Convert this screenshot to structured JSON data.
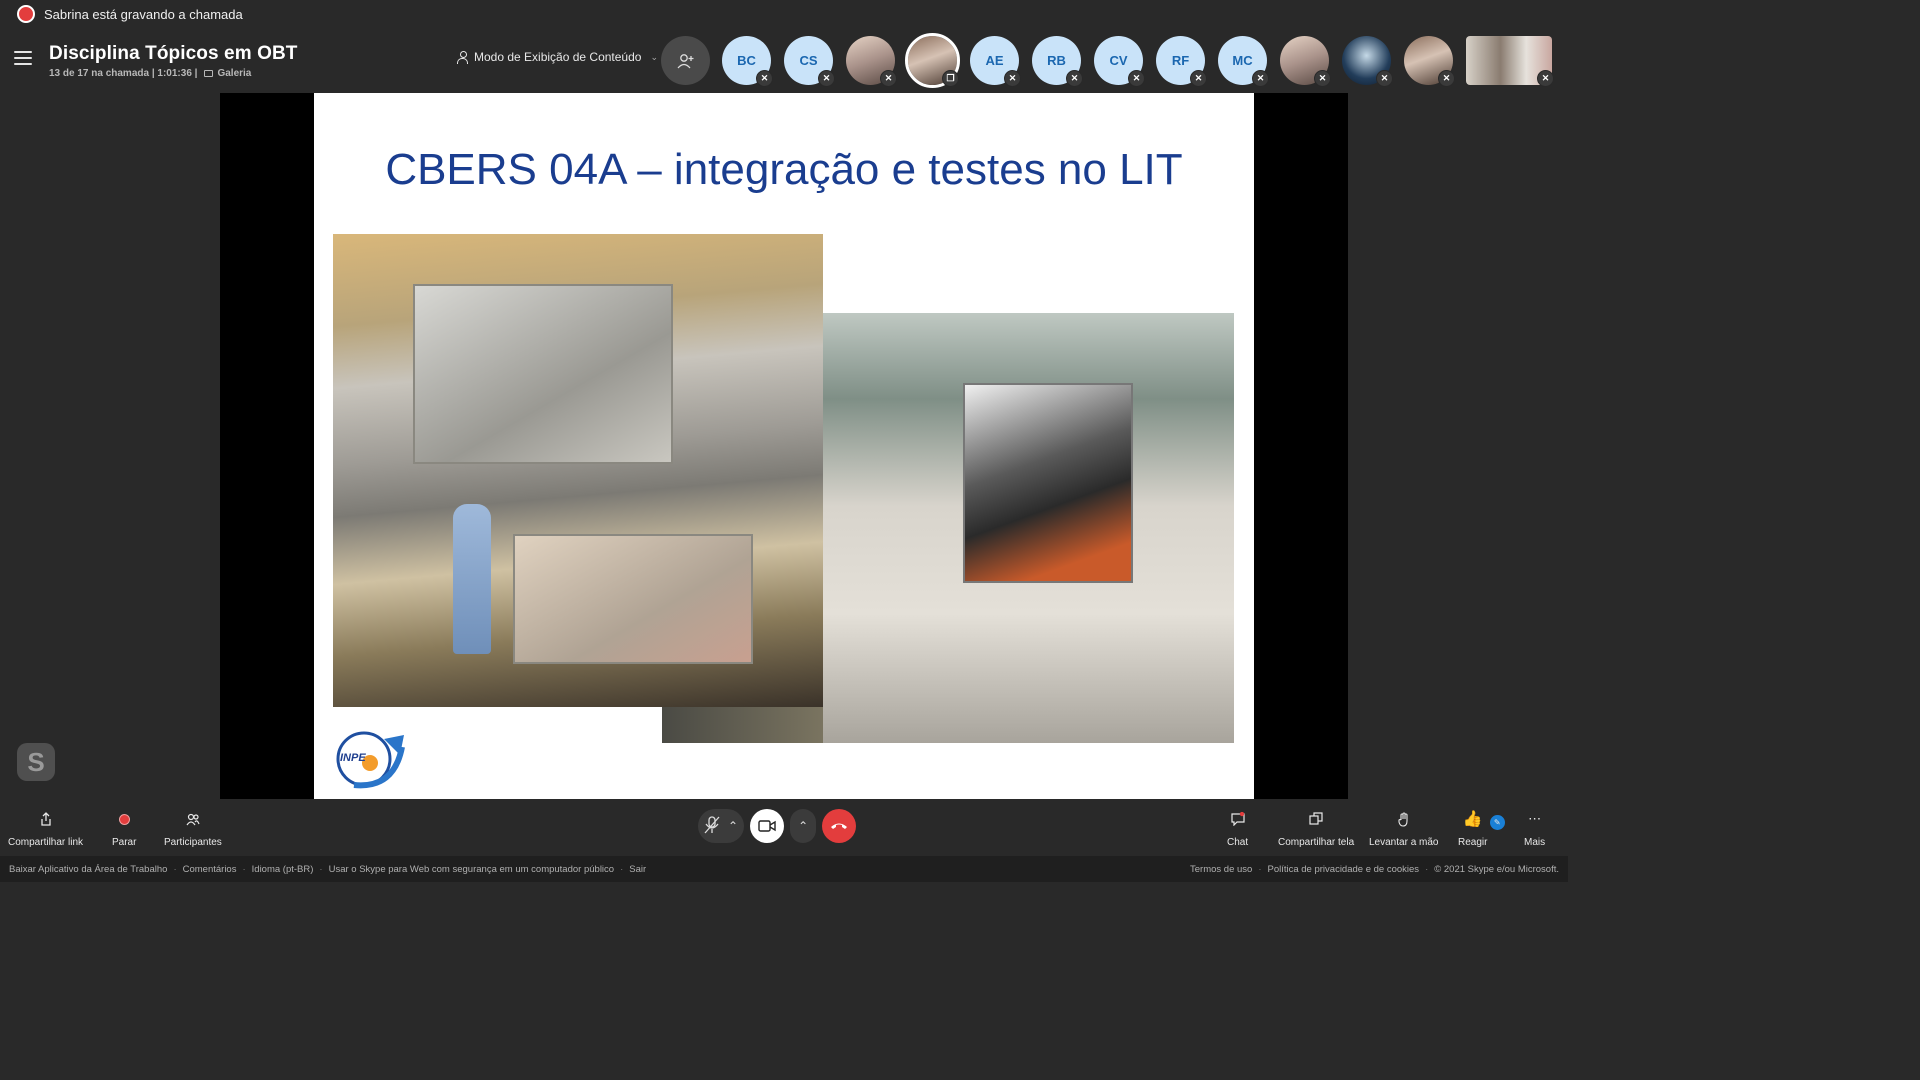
{
  "recording": {
    "text": "Sabrina está gravando a chamada"
  },
  "header": {
    "title": "Disciplina Tópicos em OBT",
    "subtitle": "13 de 17 na chamada | 1:01:36 |",
    "gallery_label": "Galeria",
    "view_mode_label": "Modo de Exibição de Conteúdo"
  },
  "participants": [
    {
      "initials": "BC",
      "kind": "initials"
    },
    {
      "initials": "CS",
      "kind": "initials"
    },
    {
      "initials": "",
      "kind": "photo"
    },
    {
      "initials": "",
      "kind": "photo-active"
    },
    {
      "initials": "AE",
      "kind": "initials"
    },
    {
      "initials": "RB",
      "kind": "initials"
    },
    {
      "initials": "CV",
      "kind": "initials"
    },
    {
      "initials": "RF",
      "kind": "initials"
    },
    {
      "initials": "MC",
      "kind": "initials"
    },
    {
      "initials": "",
      "kind": "photo"
    },
    {
      "initials": "",
      "kind": "photo"
    },
    {
      "initials": "",
      "kind": "photo"
    },
    {
      "initials": "",
      "kind": "video"
    }
  ],
  "slide": {
    "title": "CBERS 04A – integração e testes no LIT",
    "logo_text": "INPE"
  },
  "toolbar": {
    "share_link": "Compartilhar link",
    "stop": "Parar",
    "participants": "Participantes",
    "chat": "Chat",
    "share_screen": "Compartilhar tela",
    "raise_hand": "Levantar a mão",
    "react": "Reagir",
    "more": "Mais"
  },
  "footer": {
    "download": "Baixar Aplicativo da Área de Trabalho",
    "feedback": "Comentários",
    "language": "Idioma (pt-BR)",
    "secure": "Usar o Skype para Web com segurança em um computador público",
    "exit": "Sair",
    "terms": "Termos de uso",
    "privacy": "Política de privacidade e de cookies",
    "copyright": "© 2021 Skype e/ou Microsoft."
  },
  "colors": {
    "accent": "#1a3d8f",
    "record": "#e33d3d",
    "avatar_bg": "#c9e3f9"
  }
}
